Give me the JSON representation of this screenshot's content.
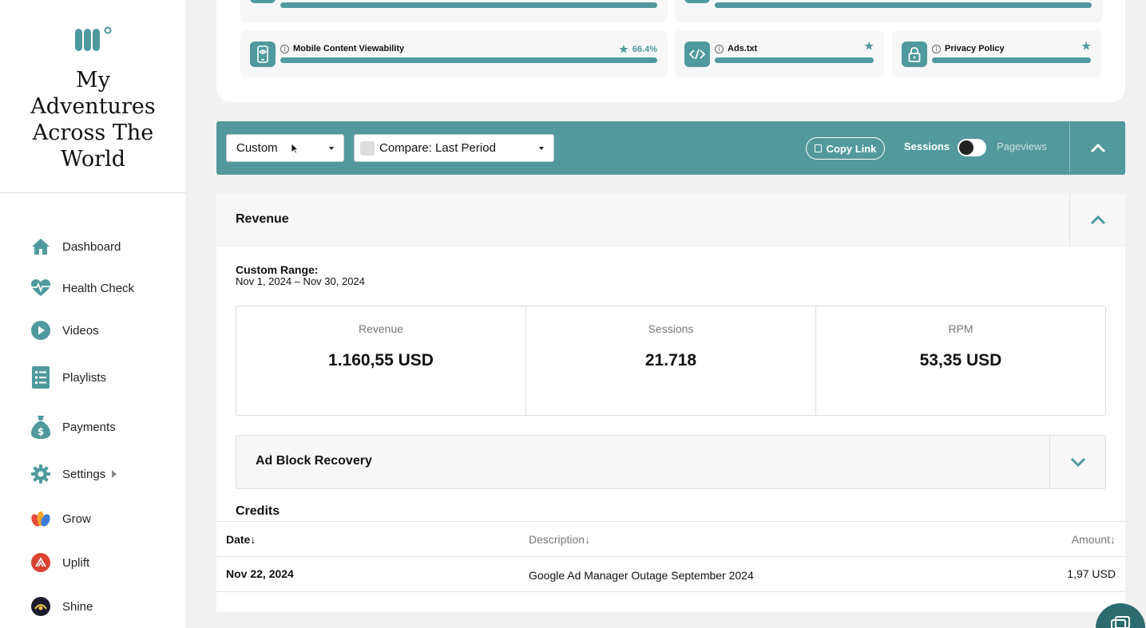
{
  "site": {
    "title": "My Adventures Across The World"
  },
  "colors": {
    "accent": "#52999d",
    "accent_dark": "#2c6b6f"
  },
  "nav": {
    "items": [
      {
        "label": "Dashboard",
        "icon": "home-icon"
      },
      {
        "label": "Health Check",
        "icon": "heartbeat-icon"
      },
      {
        "label": "Videos",
        "icon": "play-icon"
      },
      {
        "label": "Playlists",
        "icon": "list-icon"
      },
      {
        "label": "Payments",
        "icon": "money-bag-icon"
      },
      {
        "label": "Settings",
        "icon": "gear-icon"
      },
      {
        "label": "Grow",
        "icon": "grow-logo-icon"
      },
      {
        "label": "Uplift",
        "icon": "uplift-logo-icon"
      },
      {
        "label": "Shine",
        "icon": "shine-logo-icon"
      }
    ]
  },
  "health_check": {
    "items": [
      {
        "label": "Mobile Content Viewability",
        "score": "66.4%",
        "icon": "mobile-eye-icon"
      },
      {
        "label": "Ads.txt",
        "icon": "code-icon"
      },
      {
        "label": "Privacy Policy",
        "icon": "lock-icon"
      }
    ]
  },
  "filters": {
    "range_value": "Custom",
    "compare_value": "Compare: Last Period",
    "copy_link": "Copy Link",
    "toggle_left": "Sessions",
    "toggle_right": "Pageviews"
  },
  "revenue": {
    "title": "Revenue",
    "range_label": "Custom Range:",
    "range_value": "Nov 1, 2024 – Nov 30, 2024",
    "stats": [
      {
        "label": "Revenue",
        "value": "1.160,55 USD"
      },
      {
        "label": "Sessions",
        "value": "21.718"
      },
      {
        "label": "RPM",
        "value": "53,35 USD"
      }
    ],
    "ad_block_title": "Ad Block Recovery",
    "credits_title": "Credits",
    "table": {
      "headers": [
        "Date↓",
        "Description↓",
        "Amount↓"
      ],
      "rows": [
        {
          "date": "Nov 22, 2024",
          "description": "Google Ad Manager Outage September 2024",
          "amount": "1,97 USD"
        }
      ]
    }
  }
}
